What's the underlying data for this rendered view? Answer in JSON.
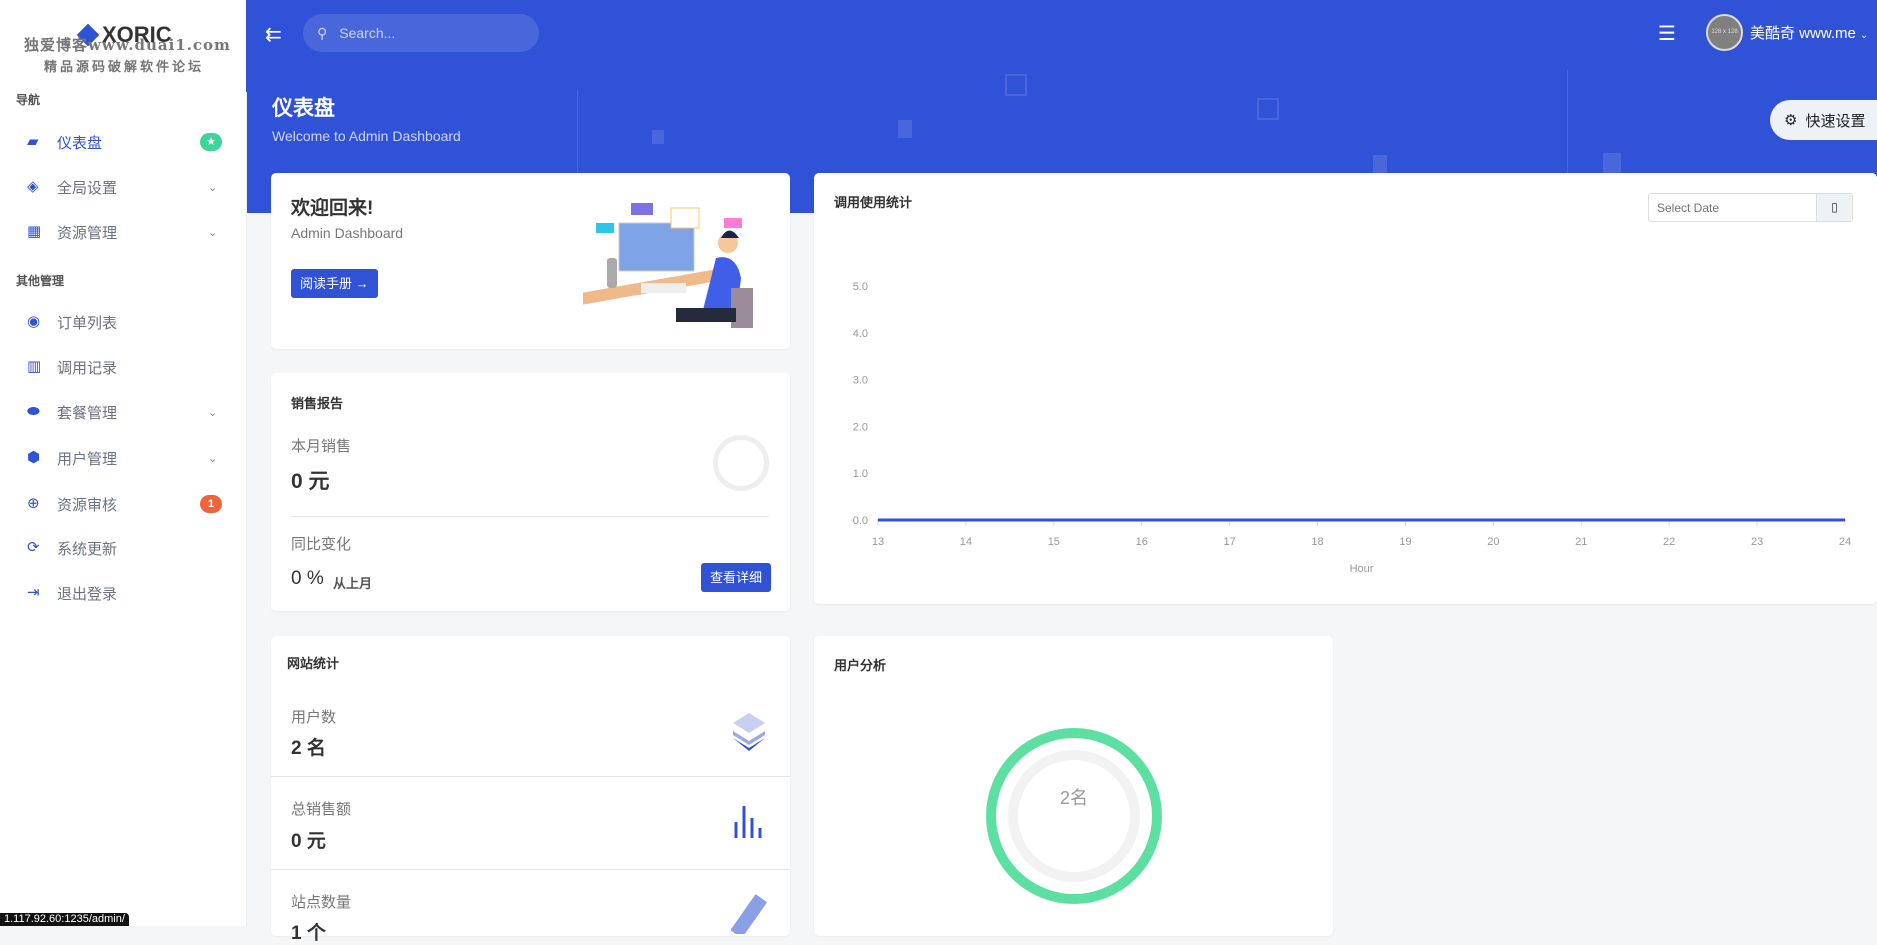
{
  "logo": {
    "text": "XORIC",
    "watermark_line1": "独爱博客www.duai1.com",
    "watermark_line2": "精品源码破解软件论坛"
  },
  "sidebar": {
    "sections": [
      {
        "label": "导航"
      },
      {
        "label": "其他管理"
      }
    ],
    "items": [
      {
        "label": "仪表盘",
        "icon": "monitor-icon",
        "badge": "★",
        "badge_color": "#3ed598",
        "active": true
      },
      {
        "label": "全局设置",
        "icon": "layers-icon",
        "chevron": true
      },
      {
        "label": "资源管理",
        "icon": "grid-icon",
        "chevron": true
      },
      {
        "label": "订单列表",
        "icon": "circle-icon"
      },
      {
        "label": "调用记录",
        "icon": "bar-chart-icon"
      },
      {
        "label": "套餐管理",
        "icon": "pill-icon",
        "chevron": true
      },
      {
        "label": "用户管理",
        "icon": "cube-icon",
        "chevron": true
      },
      {
        "label": "资源审核",
        "icon": "chat-plus-icon",
        "badge": "1",
        "badge_color": "#f0643b"
      },
      {
        "label": "系统更新",
        "icon": "refresh-icon"
      },
      {
        "label": "退出登录",
        "icon": "logout-icon"
      }
    ]
  },
  "topbar": {
    "search_placeholder": "Search...",
    "user_name": "美酷奇 www.me",
    "avatar_text": "128 x 128"
  },
  "page": {
    "title": "仪表盘",
    "subtitle": "Welcome to Admin Dashboard",
    "quick_settings": "快速设置"
  },
  "welcome": {
    "title": "欢迎回来!",
    "subtitle": "Admin Dashboard",
    "button": "阅读手册 →"
  },
  "sales": {
    "title": "销售报告",
    "month_label": "本月销售",
    "month_value": "0 元",
    "change_label": "同比变化",
    "change_value": "0 %",
    "change_suffix": "从上月",
    "details_button": "查看详细"
  },
  "site_stats": {
    "title": "网站统计",
    "items": [
      {
        "label": "用户数",
        "value": "2 名",
        "icon": "layers-icon"
      },
      {
        "label": "总销售额",
        "value": "0 元",
        "icon": "bar-chart-icon"
      },
      {
        "label": "站点数量",
        "value": "1 个",
        "icon": "ruler-icon"
      }
    ]
  },
  "user_analysis": {
    "title": "用户分析",
    "center_text": "2名",
    "ring_color": "#5ddfa1"
  },
  "usage": {
    "title": "调用使用统计",
    "date_placeholder": "Select Date"
  },
  "chart_data": {
    "type": "line",
    "x": [
      13,
      14,
      15,
      16,
      17,
      18,
      19,
      20,
      21,
      22,
      23,
      24
    ],
    "values": [
      0,
      0,
      0,
      0,
      0,
      0,
      0,
      0,
      0,
      0,
      0,
      0
    ],
    "xlabel": "Hour",
    "ylim": [
      0,
      5
    ],
    "yticks": [
      "0.0",
      "1.0",
      "2.0",
      "3.0",
      "4.0",
      "5.0"
    ],
    "color": "#3052d6"
  },
  "status_url": "1.117.92.60:1235/admin/",
  "colors": {
    "primary": "#3052d6",
    "background": "#f4f6f8"
  }
}
